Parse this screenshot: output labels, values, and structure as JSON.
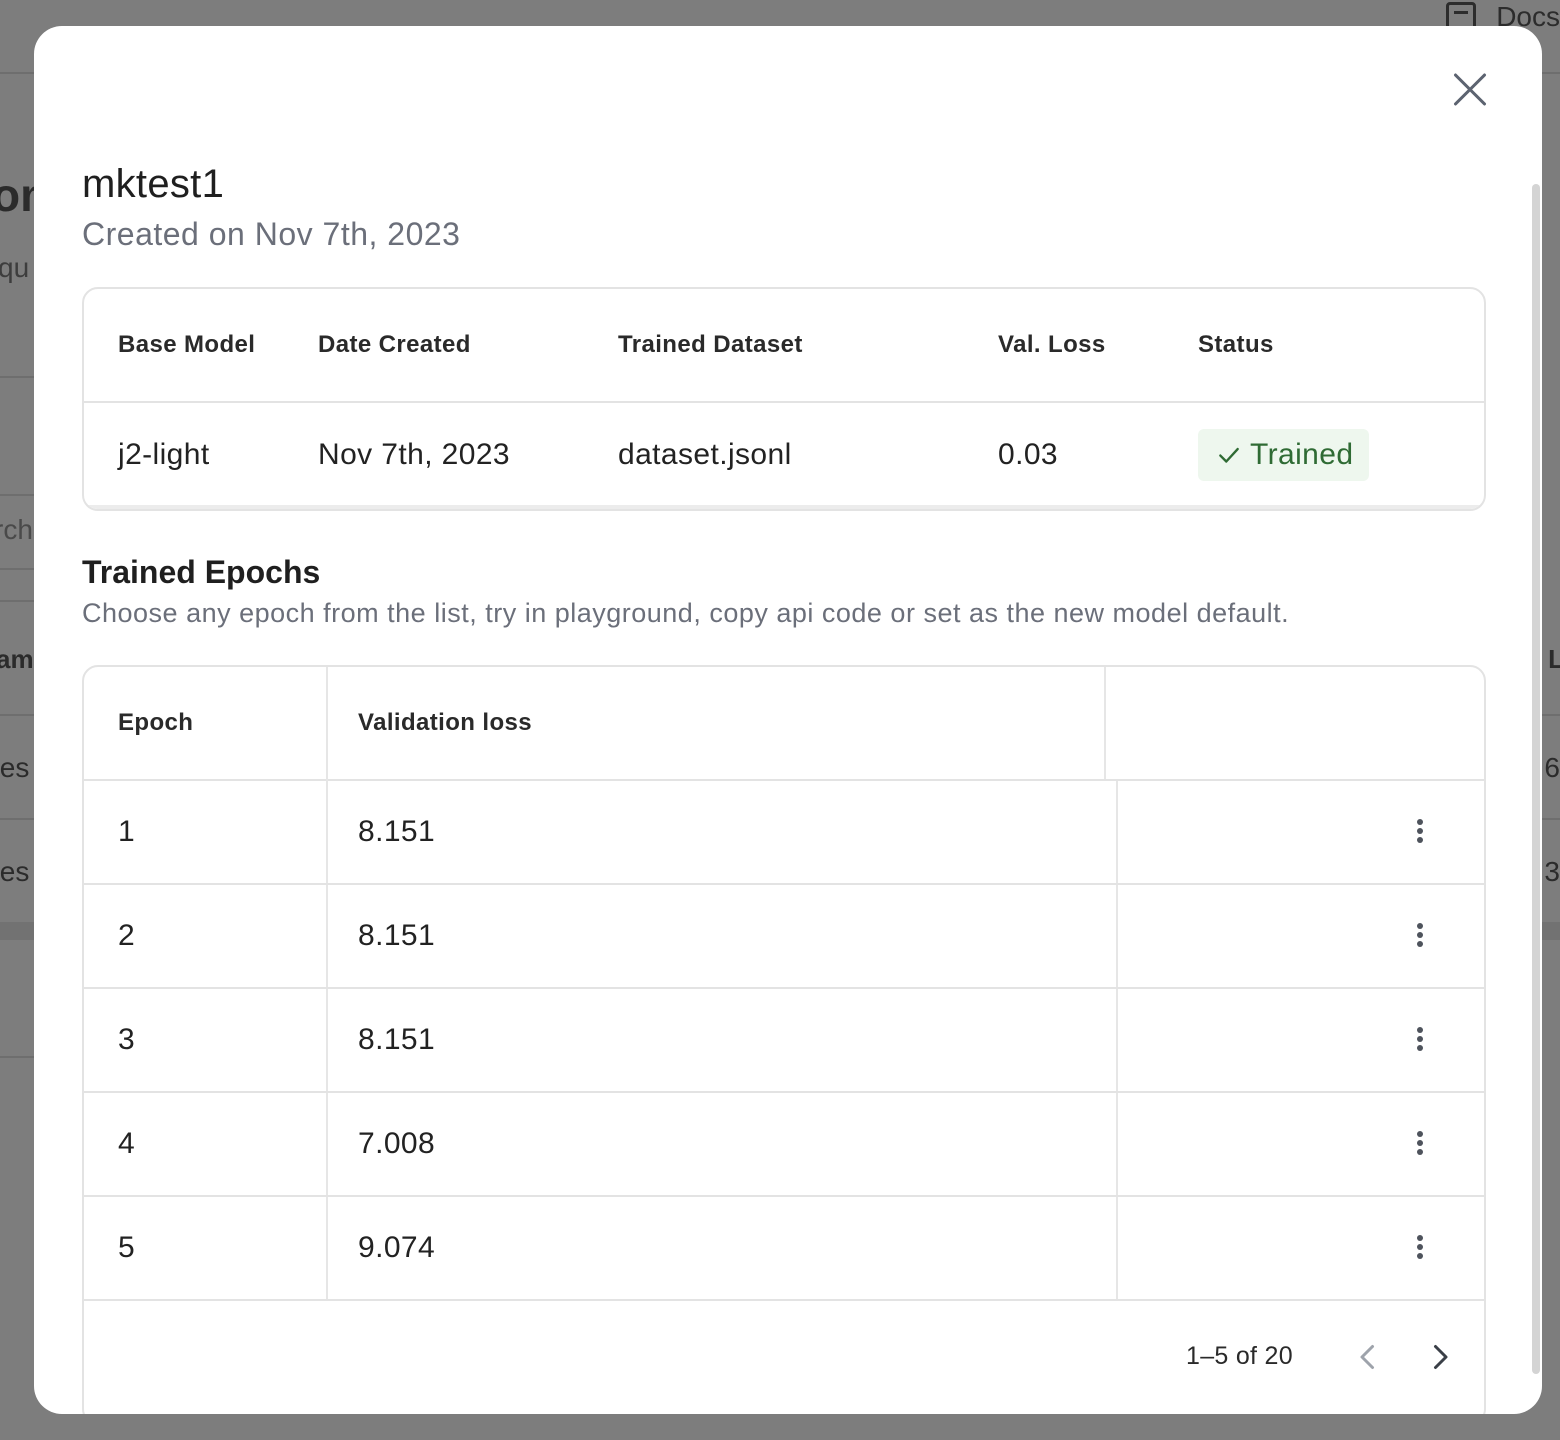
{
  "background": {
    "docs_label": "Docs",
    "title_fragment": "om",
    "subtitle_fragment": "qu",
    "search_fragment": "rch",
    "left_header_fragment": "am",
    "left_row1_fragment": "tes",
    "left_row2_fragment": "tes",
    "right_header_fragment": "L",
    "right_row1_fragment": "6",
    "right_row2_fragment": "3"
  },
  "modal": {
    "title": "mktest1",
    "created": "Created on Nov 7th, 2023",
    "info_table": {
      "headers": [
        "Base Model",
        "Date Created",
        "Trained Dataset",
        "Val. Loss",
        "Status"
      ],
      "row": {
        "base_model": "j2-light",
        "date_created": "Nov 7th, 2023",
        "trained_dataset": "dataset.jsonl",
        "val_loss": "0.03",
        "status": "Trained"
      }
    },
    "epochs": {
      "title": "Trained Epochs",
      "description": "Choose any epoch from the list, try in playground, copy api code or set as the new model default.",
      "headers": {
        "epoch": "Epoch",
        "validation_loss": "Validation loss"
      },
      "rows": [
        {
          "epoch": "1",
          "loss": "8.151"
        },
        {
          "epoch": "2",
          "loss": "8.151"
        },
        {
          "epoch": "3",
          "loss": "8.151"
        },
        {
          "epoch": "4",
          "loss": "7.008"
        },
        {
          "epoch": "5",
          "loss": "9.074"
        }
      ],
      "pagination": "1–5 of 20"
    }
  },
  "colors": {
    "overlay": "#7d7d7d",
    "status_bg": "#eef7ee",
    "status_text": "#2f6b34",
    "muted_text": "#6b6f7a"
  }
}
